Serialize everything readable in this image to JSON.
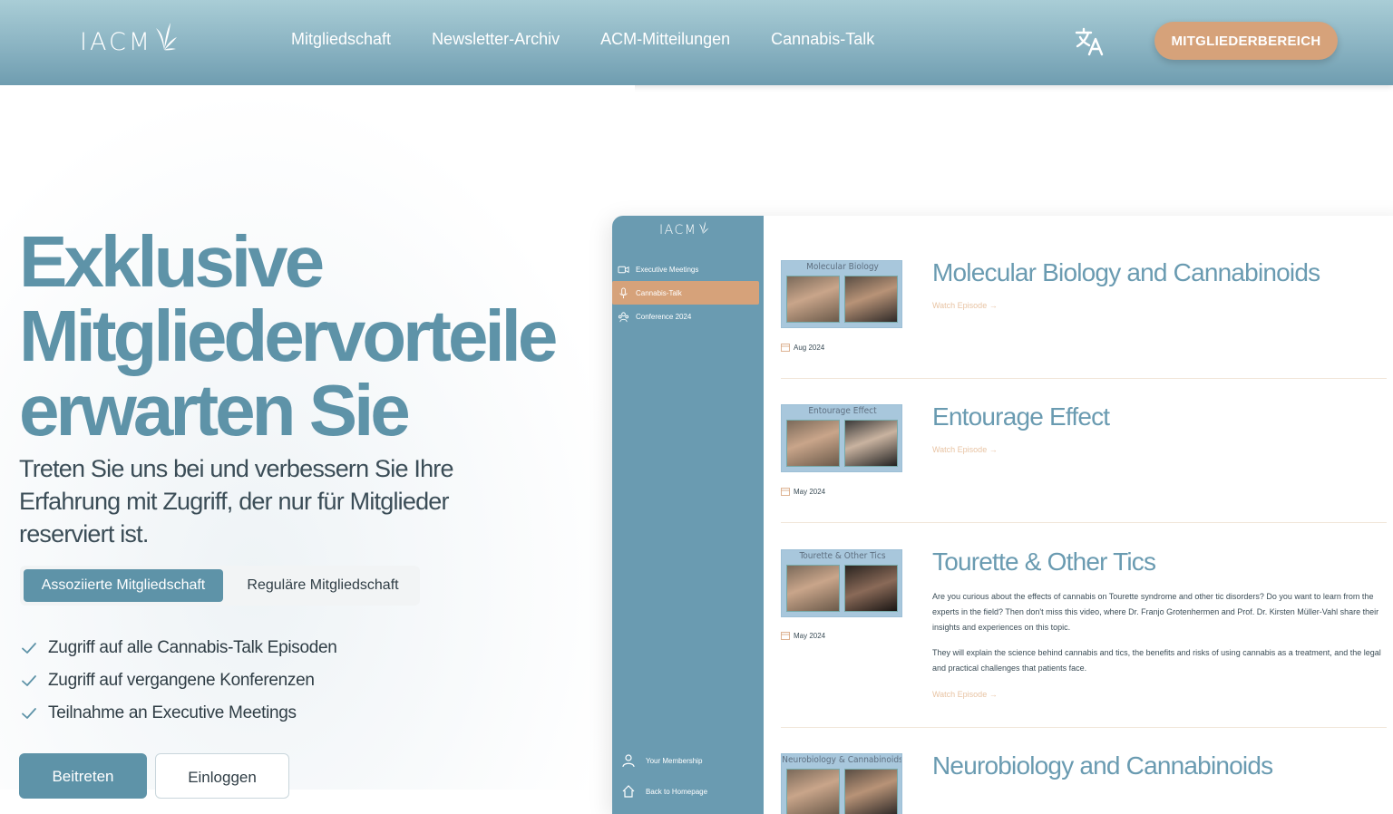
{
  "header": {
    "logo_text": "IACM",
    "nav": [
      "Mitgliedschaft",
      "Newsletter-Archiv",
      "ACM-Mitteilungen",
      "Cannabis-Talk"
    ],
    "member_button": "MITGLIEDERBEREICH",
    "brand_color": "#5e93a8",
    "accent_color": "#d6a27a"
  },
  "hero": {
    "title_lines": [
      "Exklusive",
      "Mitgliedervorteile",
      "erwarten Sie"
    ],
    "subtitle": "Treten Sie uns bei und verbessern Sie Ihre Erfahrung mit Zugriff, der nur für Mitglieder reserviert ist.",
    "tabs": [
      "Assoziierte Mitgliedschaft",
      "Reguläre Mitgliedschaft"
    ],
    "active_tab": "Assoziierte Mitgliedschaft",
    "features": [
      "Zugriff auf alle Cannabis-Talk Episoden",
      "Zugriff auf vergangene Konferenzen",
      "Teilnahme an Executive Meetings"
    ],
    "join_button": "Beitreten",
    "login_button": "Einloggen"
  },
  "preview": {
    "logo_text": "IACM",
    "nav": [
      {
        "label": "Executive Meetings",
        "icon": "video-icon"
      },
      {
        "label": "Cannabis-Talk",
        "icon": "microphone-icon"
      },
      {
        "label": "Conference 2024",
        "icon": "users-icon"
      }
    ],
    "active_nav": "Cannabis-Talk",
    "bottom_nav": [
      {
        "label": "Your Membership",
        "icon": "user-icon"
      },
      {
        "label": "Back to Homepage",
        "icon": "home-icon"
      }
    ],
    "episodes": [
      {
        "thumb_title": "Molecular Biology",
        "date": "Aug 2024",
        "title": "Molecular Biology and Cannabinoids",
        "watch": "Watch Episode →",
        "description": []
      },
      {
        "thumb_title": "Entourage Effect",
        "date": "May 2024",
        "title": "Entourage Effect",
        "watch": "Watch Episode →",
        "description": []
      },
      {
        "thumb_title": "Tourette & Other Tics",
        "date": "May 2024",
        "title": "Tourette & Other Tics",
        "watch": "Watch Episode →",
        "description": [
          "Are you curious about the effects of cannabis on Tourette syndrome and other tic disorders? Do you want to learn from the experts in the field? Then don't miss this video, where Dr. Franjo Grotenhermen and Prof. Dr. Kirsten Müller-Vahl share their insights and experiences on this topic.",
          "They will explain the science behind cannabis and tics, the benefits and risks of using cannabis as a treatment, and the legal and practical challenges that patients face."
        ]
      },
      {
        "thumb_title": "Neurobiology & Cannabinoids",
        "date": "",
        "title": "Neurobiology and Cannabinoids",
        "watch": "",
        "description": []
      }
    ]
  }
}
